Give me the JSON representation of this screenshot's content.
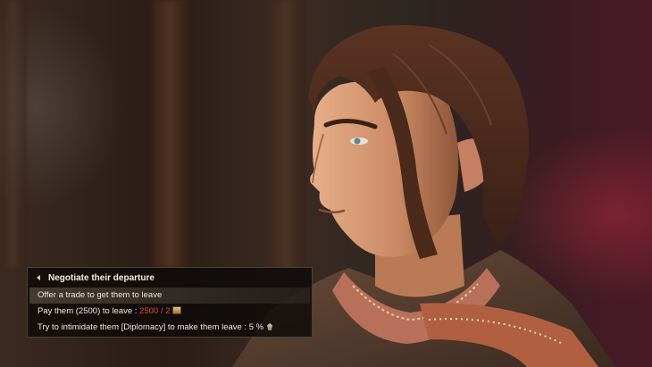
{
  "dialog": {
    "title": "Negotiate their departure",
    "options": [
      {
        "label": "Offer a trade to get them to leave"
      },
      {
        "label": "Pay them (2500) to leave : ",
        "cost": "2500 / 2"
      },
      {
        "label": "Try to intimidate them [Diplomacy] to make them leave : 5 %"
      }
    ]
  },
  "icons": {
    "back": "back-arrow-icon",
    "gold": "gold-coins-icon",
    "chance": "gem-icon"
  },
  "colors": {
    "cost_insufficient": "#e0453d",
    "text": "#ece6dd"
  }
}
